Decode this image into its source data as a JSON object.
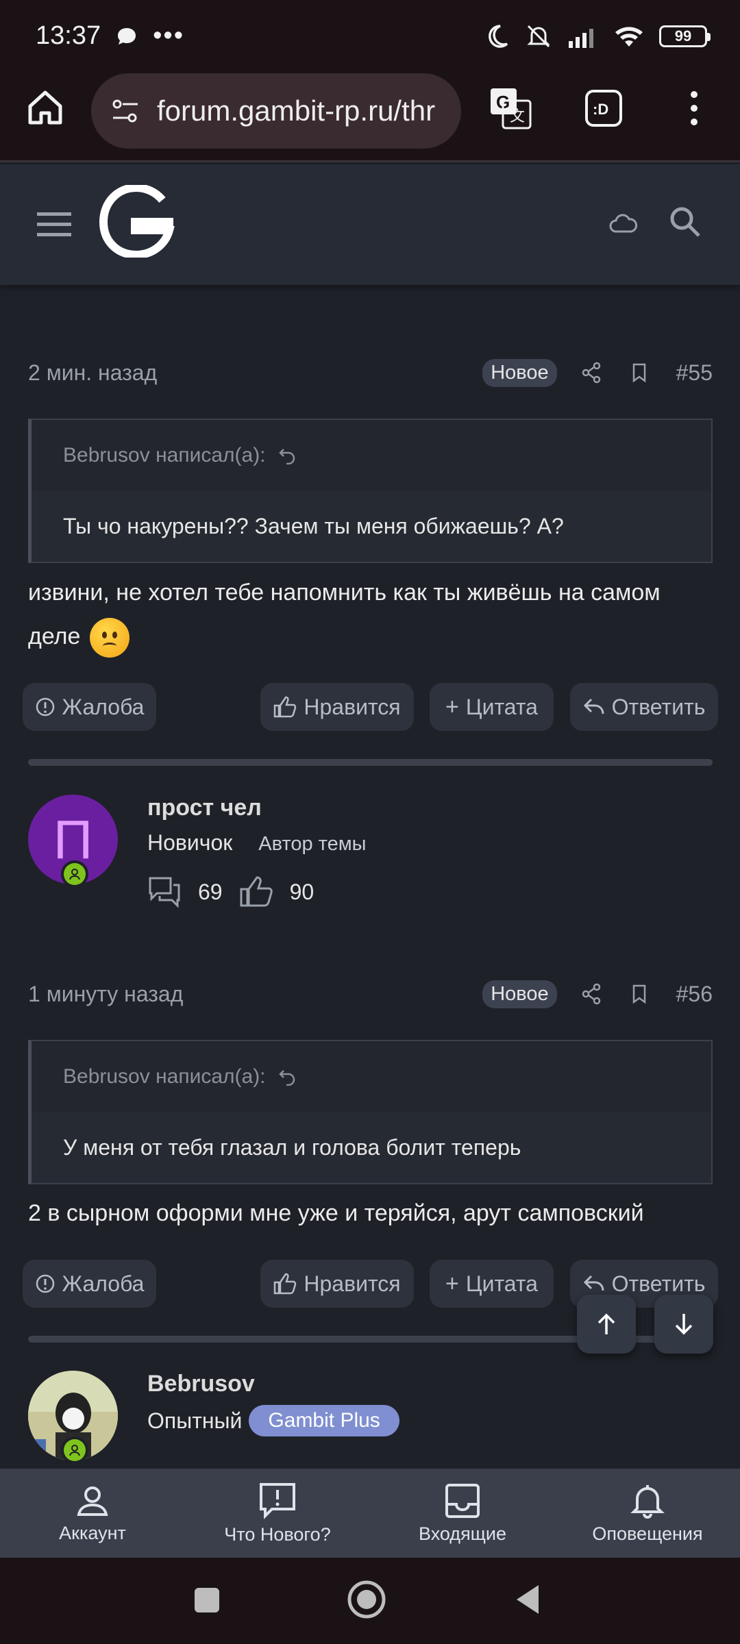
{
  "status_bar": {
    "time": "13:37",
    "battery": "99"
  },
  "browser": {
    "url": "forum.gambit-rp.ru/thr"
  },
  "posts": [
    {
      "date": "2 мин. назад",
      "badge": "Новое",
      "number": "#55",
      "quote_author": "Bebrusov написал(а):",
      "quote_text": "Ты чо накурены?? Зачем ты меня обижаешь? А?",
      "text_line1": "извини, не хотел тебе напомнить как ты живёшь на самом",
      "text_line2": "деле"
    },
    {
      "date": "1 минуту назад",
      "badge": "Новое",
      "number": "#56",
      "quote_author": "Bebrusov написал(а):",
      "quote_text": "У меня от тебя глазал и голова болит теперь",
      "text_line1": "2 в сырном оформи мне уже и теряйся, арут самповский"
    }
  ],
  "actions": {
    "report": "Жалоба",
    "like": "Нравится",
    "quote": "Цитата",
    "reply": "Ответить"
  },
  "user1": {
    "name": "прост чел",
    "avatar_letter": "П",
    "title": "Новичок",
    "role": "Автор темы",
    "messages": "69",
    "likes": "90"
  },
  "user2": {
    "name": "Bebrusov",
    "title": "Опытный",
    "badge": "Gambit Plus"
  },
  "bottom_nav": [
    {
      "label": "Аккаунт",
      "icon": "user-icon"
    },
    {
      "label": "Что Нового?",
      "icon": "alert-bubble-icon"
    },
    {
      "label": "Входящие",
      "icon": "inbox-icon"
    },
    {
      "label": "Оповещения",
      "icon": "bell-icon"
    }
  ]
}
